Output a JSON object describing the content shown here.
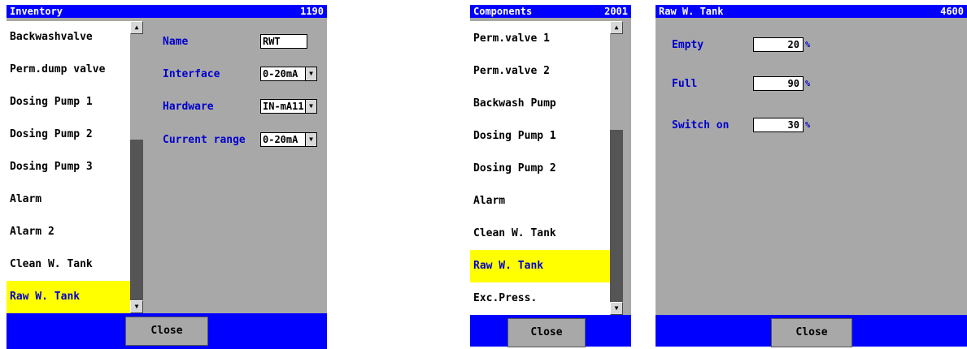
{
  "inventory": {
    "title": "Inventory",
    "number": "1190",
    "items": [
      "Backwashvalve",
      "Perm.dump valve",
      "Dosing Pump 1",
      "Dosing Pump 2",
      "Dosing Pump 3",
      "Alarm",
      "Alarm 2",
      "Clean W. Tank",
      "Raw W. Tank"
    ],
    "selected_index": 8,
    "fields": {
      "name_label": "Name",
      "name_value": "RWT",
      "interface_label": "Interface",
      "interface_value": "0-20mA",
      "hardware_label": "Hardware",
      "hardware_value": "IN-mA11",
      "range_label": "Current range",
      "range_value": "0-20mA"
    },
    "close_label": "Close"
  },
  "components": {
    "title": "Components",
    "number": "2001",
    "items": [
      "Perm.valve 1",
      "Perm.valve 2",
      "Backwash Pump",
      "Dosing Pump 1",
      "Dosing Pump 2",
      "Alarm",
      "Clean W. Tank",
      "Raw W. Tank",
      "Exc.Press."
    ],
    "selected_index": 7,
    "close_label": "Close"
  },
  "raw_tank": {
    "title": "Raw W. Tank",
    "number": "4600",
    "empty_label": "Empty",
    "empty_value": "20",
    "empty_unit": "%",
    "full_label": "Full",
    "full_value": "90",
    "full_unit": "%",
    "switch_label": "Switch on",
    "switch_value": "30",
    "switch_unit": "%",
    "close_label": "Close"
  },
  "icons": {
    "scroll_up": "up-arrow-icon",
    "scroll_down": "down-arrow-icon",
    "dropdown": "dropdown-arrow-icon"
  },
  "colors": {
    "titlebar": "#0000ff",
    "panel": "#a8a8a8",
    "selected": "#ffff00",
    "label": "#0000cc"
  }
}
